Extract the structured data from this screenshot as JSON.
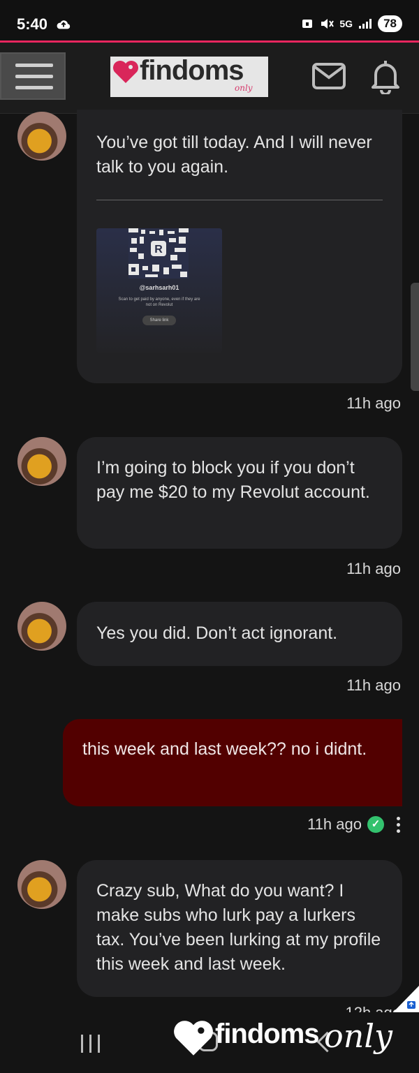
{
  "status_bar": {
    "time": "5:40",
    "battery": "78",
    "network": "5G"
  },
  "header": {
    "logo_text": "findoms",
    "logo_sub": "only",
    "menu_icon": "hamburger-icon",
    "mail_icon": "mail-icon",
    "bell_icon": "bell-icon"
  },
  "messages": [
    {
      "text": "You’ve got till today. And I will never talk to you again.",
      "attachment": {
        "handle": "@sarhsarh01",
        "desc": "Scan to get paid by anyone, even if they are not on Revolut",
        "share_label": "Share link"
      },
      "time": "11h ago"
    },
    {
      "text": "I’m going to block you if you don’t pay me $20 to my Revolut account.",
      "time": "11h ago"
    },
    {
      "text": "Yes you did. Don’t act ignorant.",
      "time": "11h ago"
    },
    {
      "text": "this week and last week?? no i didnt.",
      "time": "11h ago",
      "sent": true
    },
    {
      "text": "Crazy sub, What do you want? I make subs who lurk pay a lurkers tax. You’ve been lurking at my profile this week and last week.",
      "time": "12h ago"
    }
  ],
  "watermark": {
    "text": "findoms",
    "sub": "only"
  },
  "colors": {
    "accent": "#e8265f",
    "sent_bubble": "#520000",
    "received_bubble": "#222224"
  }
}
